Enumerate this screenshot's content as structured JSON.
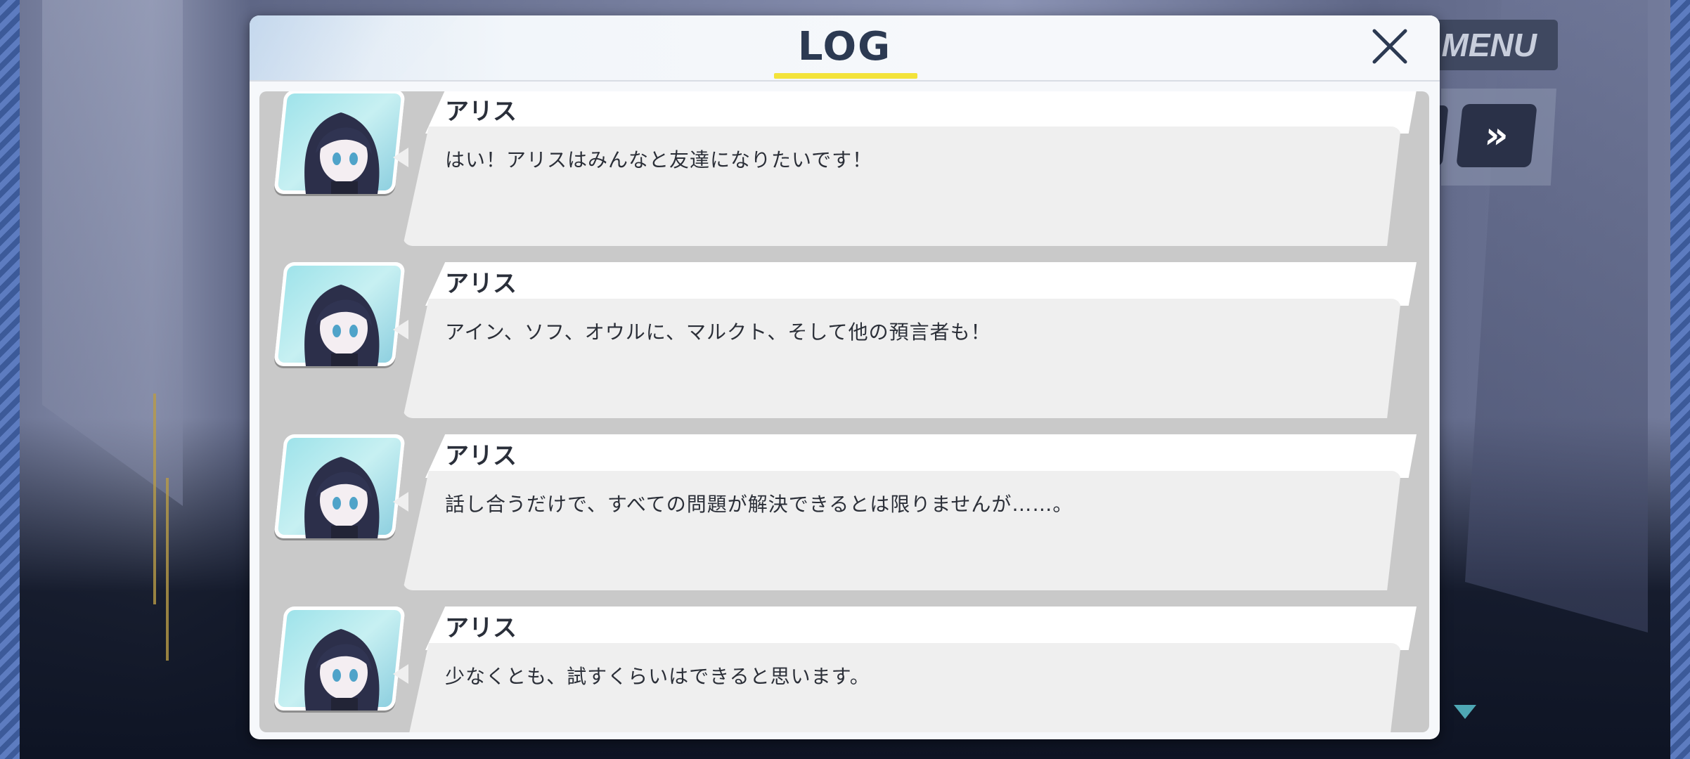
{
  "hud": {
    "menu_label": "MENU",
    "fast_forward_glyph": "»",
    "scroll_indicator": "down-triangle-icon"
  },
  "log": {
    "title": "LOG",
    "close_icon": "close-icon",
    "accent_color": "#f3e33a",
    "entries": [
      {
        "speaker": "アリス",
        "message": "はい！アリスはみんなと友達になりたいです！"
      },
      {
        "speaker": "アリス",
        "message": "アイン、ソフ、オウルに、マルクト、そして他の預言者も！"
      },
      {
        "speaker": "アリス",
        "message": "話し合うだけで、すべての問題が解決できるとは限りませんが……。"
      },
      {
        "speaker": "アリス",
        "message": "少なくとも、試すくらいはできると思います。"
      }
    ]
  }
}
